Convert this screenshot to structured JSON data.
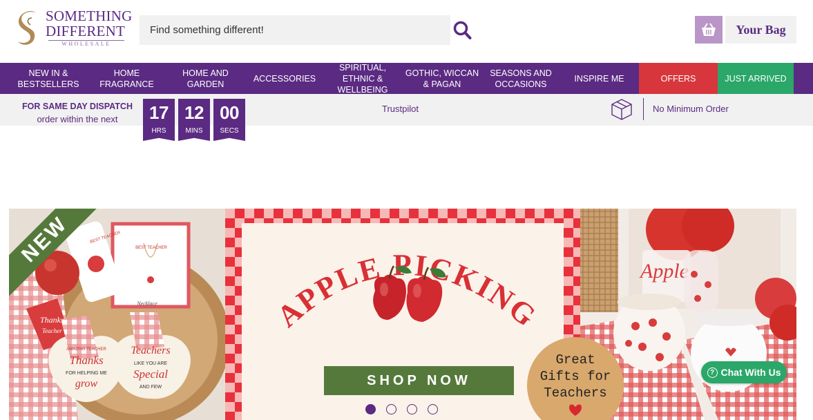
{
  "header": {
    "logo": {
      "line1": "SOMETHING",
      "line2": "DIFFERENT",
      "line3": "WHOLESALE"
    },
    "search": {
      "placeholder": "Find something different!",
      "icon": "search-icon"
    },
    "bag": {
      "label": "Your Bag",
      "icon": "basket-icon"
    }
  },
  "nav": {
    "items": [
      {
        "label": "NEW IN & BESTSELLERS"
      },
      {
        "label": "HOME FRAGRANCE"
      },
      {
        "label": "HOME AND GARDEN"
      },
      {
        "label": "ACCESSORIES"
      },
      {
        "label": "SPIRITUAL, ETHNIC & WELLBEING"
      },
      {
        "label": "GOTHIC, WICCAN & PAGAN"
      },
      {
        "label": "SEASONS AND OCCASIONS"
      },
      {
        "label": "INSPIRE ME"
      },
      {
        "label": "OFFERS"
      },
      {
        "label": "JUST ARRIVED"
      }
    ],
    "colors": {
      "main": "#5b2a82",
      "offers": "#d7373c",
      "just_arrived": "#2aa769"
    }
  },
  "dispatch": {
    "title": "FOR SAME DAY DISPATCH",
    "subtitle": "order within the next",
    "countdown": [
      {
        "value": "17",
        "unit": "HRS"
      },
      {
        "value": "12",
        "unit": "MINS"
      },
      {
        "value": "00",
        "unit": "SECS"
      }
    ],
    "trustpilot": "Trustpilot",
    "min_order": "No Minimum Order"
  },
  "banner": {
    "badge": "NEW",
    "headline": "APPLE PICKING",
    "cta": "SHOP NOW",
    "sticker": [
      "Great",
      "Gifts for",
      "Teachers"
    ],
    "products": {
      "keyring_tag": "BEST TEACHER",
      "card_tag": "BEST TEACHER",
      "necklace_label": "Necklace",
      "tag": [
        "Thanks",
        "Teacher"
      ],
      "plaque1": [
        "AMAZING TEACHER",
        "Thanks",
        "FOR HELPING ME",
        "grow"
      ],
      "plaque2": [
        "Teachers",
        "LIKE YOU ARE",
        "Special",
        "AND FEW"
      ],
      "jar_text": "Apple"
    },
    "slides": 4,
    "active_slide": 1
  },
  "chat": {
    "label": "Chat With Us",
    "icon": "help-circle-icon"
  }
}
